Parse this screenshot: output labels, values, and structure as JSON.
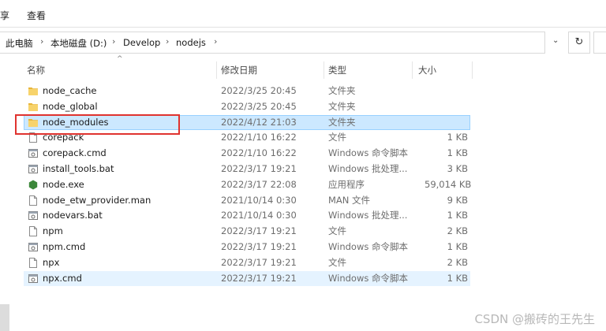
{
  "ribbon": {
    "tab_partial": "享",
    "tab_view": "查看"
  },
  "breadcrumb": [
    "此电脑",
    "本地磁盘 (D:)",
    "Develop",
    "nodejs"
  ],
  "columns": {
    "name": "名称",
    "date": "修改日期",
    "type": "类型",
    "size": "大小"
  },
  "files": [
    {
      "name": "node_cache",
      "date": "2022/3/25 20:45",
      "type": "文件夹",
      "size": "",
      "icon": "folder-icon"
    },
    {
      "name": "node_global",
      "date": "2022/3/25 20:45",
      "type": "文件夹",
      "size": "",
      "icon": "folder-icon"
    },
    {
      "name": "node_modules",
      "date": "2022/4/12 21:03",
      "type": "文件夹",
      "size": "",
      "icon": "folder-icon",
      "selected": true
    },
    {
      "name": "corepack",
      "date": "2022/1/10 16:22",
      "type": "文件",
      "size": "1 KB",
      "icon": "file-icon"
    },
    {
      "name": "corepack.cmd",
      "date": "2022/1/10 16:22",
      "type": "Windows 命令脚本",
      "size": "1 KB",
      "icon": "script-icon"
    },
    {
      "name": "install_tools.bat",
      "date": "2022/3/17 19:21",
      "type": "Windows 批处理...",
      "size": "3 KB",
      "icon": "script-icon"
    },
    {
      "name": "node.exe",
      "date": "2022/3/17 22:08",
      "type": "应用程序",
      "size": "59,014 KB",
      "icon": "node-exe-icon"
    },
    {
      "name": "node_etw_provider.man",
      "date": "2021/10/14 0:30",
      "type": "MAN 文件",
      "size": "9 KB",
      "icon": "file-icon"
    },
    {
      "name": "nodevars.bat",
      "date": "2021/10/14 0:30",
      "type": "Windows 批处理...",
      "size": "1 KB",
      "icon": "script-icon"
    },
    {
      "name": "npm",
      "date": "2022/3/17 19:21",
      "type": "文件",
      "size": "2 KB",
      "icon": "file-icon"
    },
    {
      "name": "npm.cmd",
      "date": "2022/3/17 19:21",
      "type": "Windows 命令脚本",
      "size": "1 KB",
      "icon": "script-icon"
    },
    {
      "name": "npx",
      "date": "2022/3/17 19:21",
      "type": "文件",
      "size": "2 KB",
      "icon": "file-icon"
    },
    {
      "name": "npx.cmd",
      "date": "2022/3/17 19:21",
      "type": "Windows 命令脚本",
      "size": "1 KB",
      "icon": "script-icon",
      "hover": true
    }
  ],
  "watermark": "CSDN @搬砖的王先生",
  "colors": {
    "folder": "#f4c542",
    "selection": "#cce8ff",
    "highlight_box": "#e0332f",
    "node_green": "#3c873a"
  }
}
